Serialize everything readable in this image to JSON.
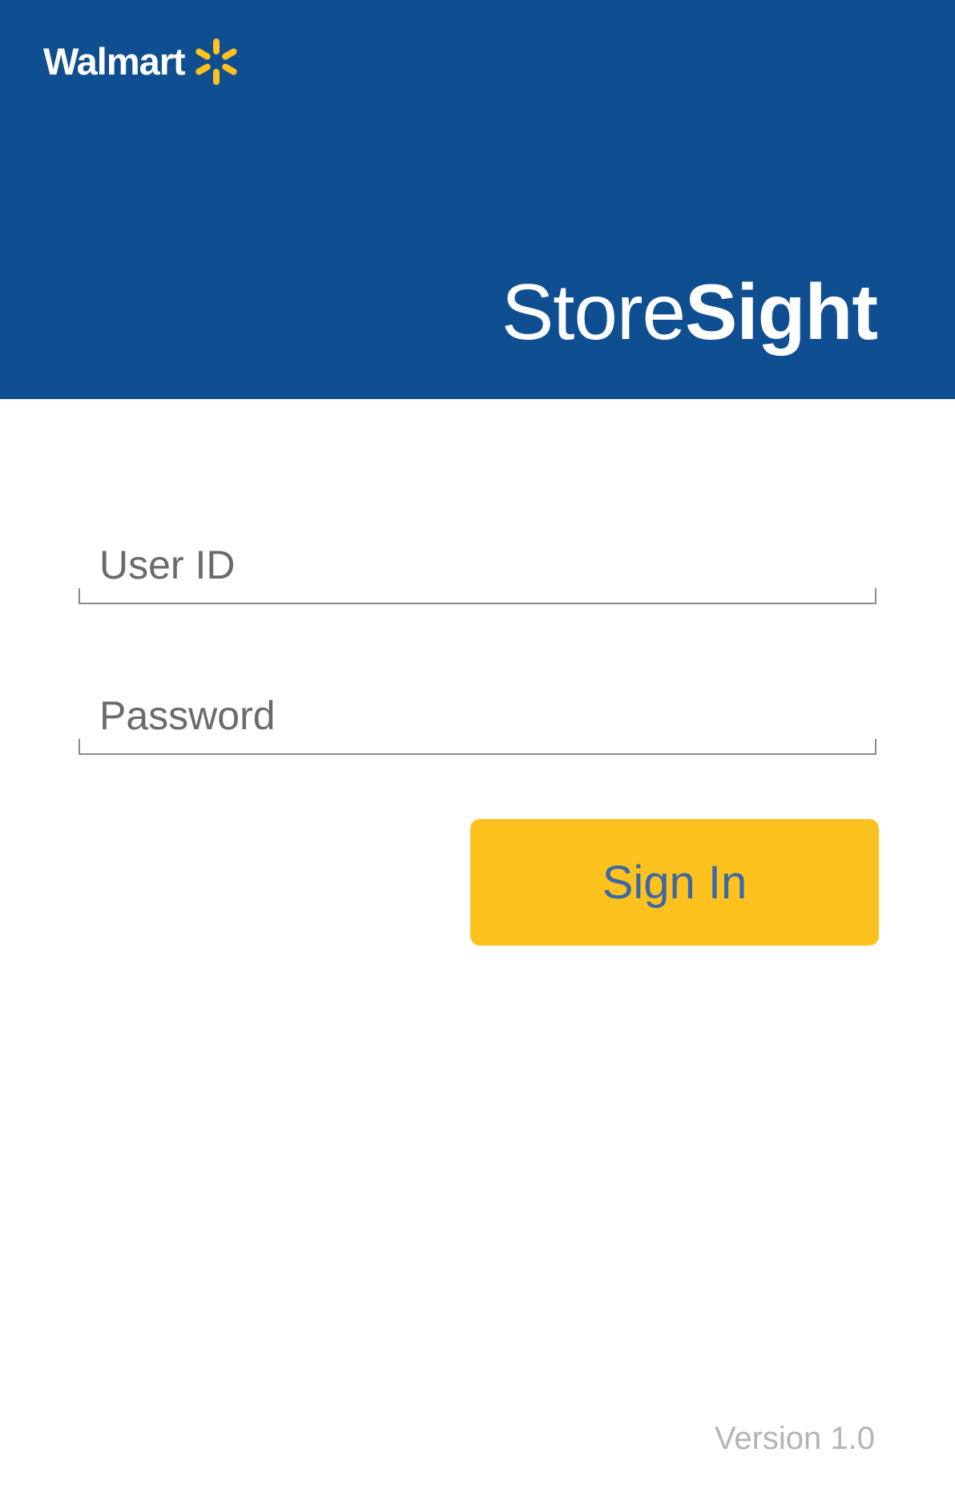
{
  "header": {
    "brand_name": "Walmart",
    "brand_logo_icon": "spark-icon",
    "app_title_light": "Store",
    "app_title_bold": "Sight"
  },
  "form": {
    "user_id_placeholder": "User ID",
    "password_placeholder": "Password",
    "sign_in_label": "Sign In"
  },
  "footer": {
    "version": "Version 1.0"
  },
  "colors": {
    "header_bg": "#0f4e91",
    "spark": "#fec21f",
    "button_bg": "#fec21f",
    "button_text": "#3a68a6"
  }
}
